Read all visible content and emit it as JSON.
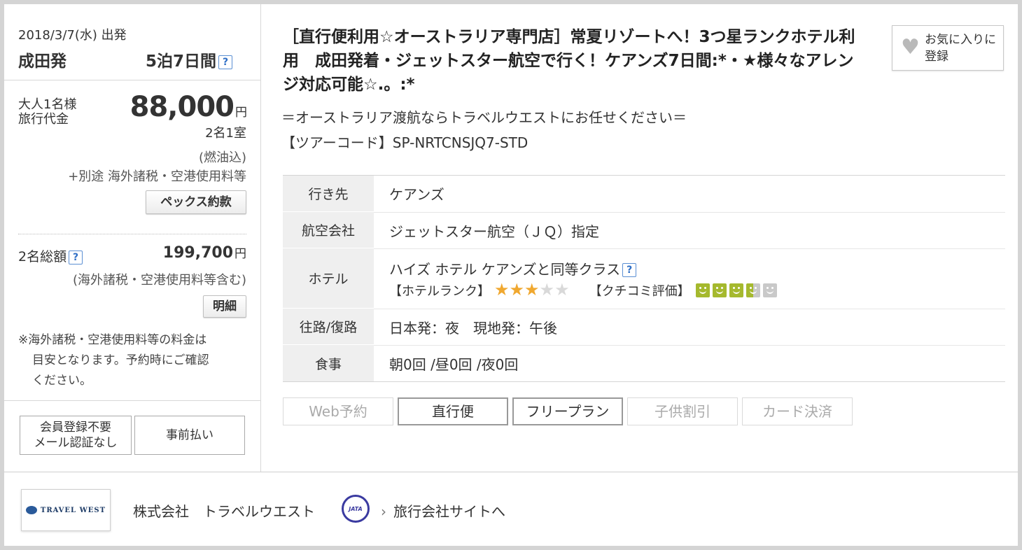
{
  "summary": {
    "date_departure": "2018/3/7(水) 出発",
    "origin": "成田発",
    "duration": "5泊7日間",
    "help": "?"
  },
  "pricing": {
    "per_person_label_1": "大人1名様",
    "per_person_label_2": "旅行代金",
    "price": "88,000",
    "currency": "円",
    "room_info": "2名1室",
    "fuel_note": "(燃油込)",
    "extra_note": "+別途 海外諸税・空港使用料等",
    "terms_button": "ペックス約款",
    "total_label": "2名総額",
    "total_price": "199,700",
    "total_note": "(海外諸税・空港使用料等含む)",
    "detail_button": "明細",
    "disclaimer_1": "※海外諸税・空港使用料等の料金は",
    "disclaimer_2": "目安となります。予約時にご確認",
    "disclaimer_3": "ください。"
  },
  "badges": {
    "no_registration_1": "会員登録不要",
    "no_registration_2": "メール認証なし",
    "prepay": "事前払い"
  },
  "tour": {
    "title": "［直行便利用☆オーストラリア専門店］常夏リゾートへ！3つ星ランクホテル利用　成田発着・ジェットスター航空で行く！ケアンズ7日間:*・★様々なアレンジ対応可能☆.。:*",
    "tagline": "＝オーストラリア渡航ならトラベルウエストにお任せください＝",
    "tour_code": "【ツアーコード】SP-NRTCNSJQ7-STD"
  },
  "favorite": {
    "label": "お気に入りに登録",
    "icon": "heart-icon"
  },
  "details": {
    "destination_label": "行き先",
    "destination": "ケアンズ",
    "airline_label": "航空会社",
    "airline": "ジェットスター航空（ＪＱ）指定",
    "hotel_label": "ホテル",
    "hotel": "ハイズ ホテル ケアンズと同等クラス",
    "hotel_rank_label": "【ホテルランク】",
    "hotel_rank": 3,
    "hotel_rank_max": 5,
    "review_label": "【クチコミ評価】",
    "review_rating": 3.5,
    "review_max": 5,
    "route_label": "往路/復路",
    "route": "日本発：夜　現地発：午後",
    "meals_label": "食事",
    "meals": "朝0回 /昼0回 /夜0回"
  },
  "features": [
    {
      "label": "Web予約",
      "active": false
    },
    {
      "label": "直行便",
      "active": true
    },
    {
      "label": "フリープラン",
      "active": true
    },
    {
      "label": "子供割引",
      "active": false
    },
    {
      "label": "カード決済",
      "active": false
    }
  ],
  "footer": {
    "logo_text": "TRAVEL WEST",
    "company": "株式会社　トラベルウエスト",
    "jata_text": "JATA",
    "agency_link": "旅行会社サイトへ"
  },
  "colors": {
    "star_on": "#f0a830",
    "star_off": "#d9d9d9",
    "smile_on": "#a5b92e",
    "smile_off": "#c9c9c9",
    "help_blue": "#2f6fc6"
  }
}
